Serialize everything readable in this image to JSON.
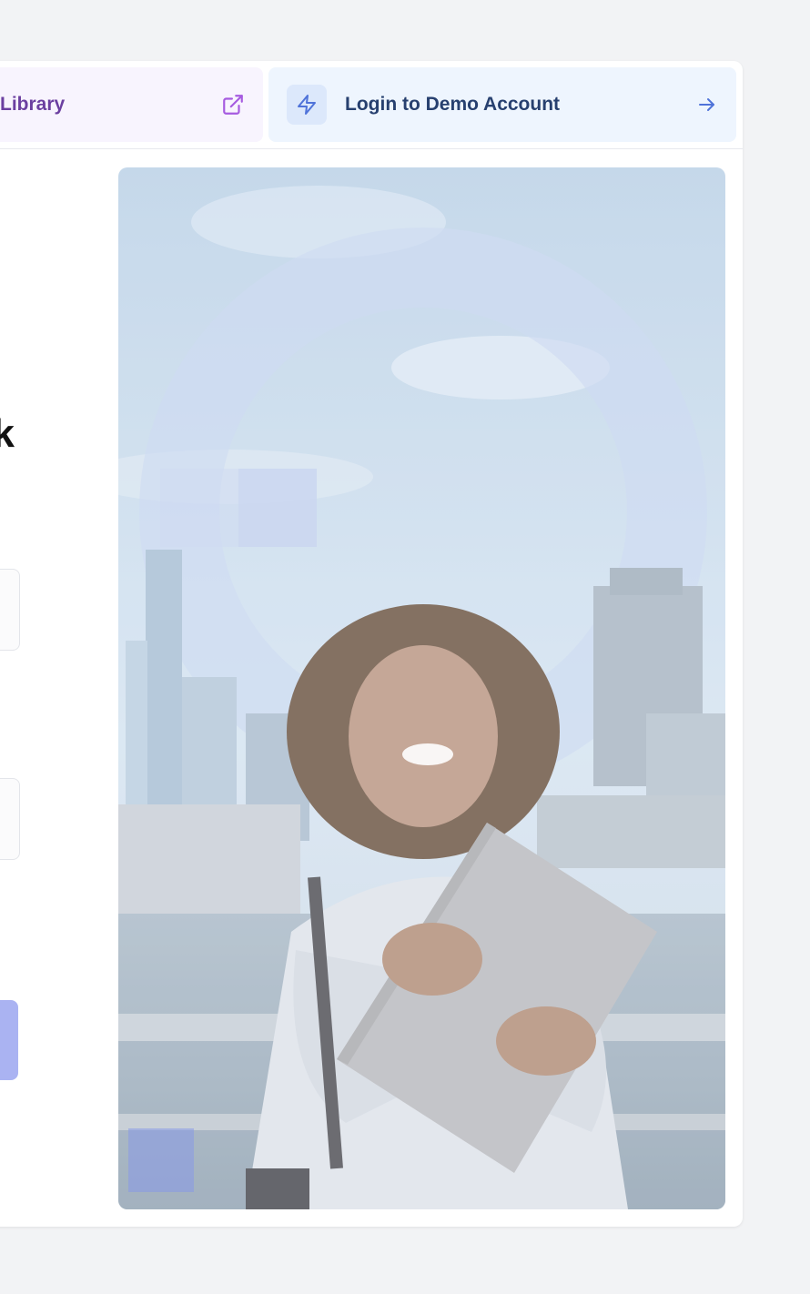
{
  "topbar": {
    "library_label": "Library",
    "library_icon": "external-link-icon",
    "demo_label": "Login to Demo Account",
    "demo_icon": "lightning-bolt-icon",
    "demo_arrow_icon": "arrow-right-icon"
  },
  "heading": {
    "visible_fragment": "k"
  },
  "hero_image": {
    "description_icon": "hero-photo-woman-with-laptop"
  },
  "colors": {
    "library_bg": "#f8f4fe",
    "library_text": "#6b3fa0",
    "demo_bg": "#eef5fe",
    "demo_text": "#27406f",
    "accent_blue": "#4f73d9",
    "submit_button": "#aab3f2"
  }
}
